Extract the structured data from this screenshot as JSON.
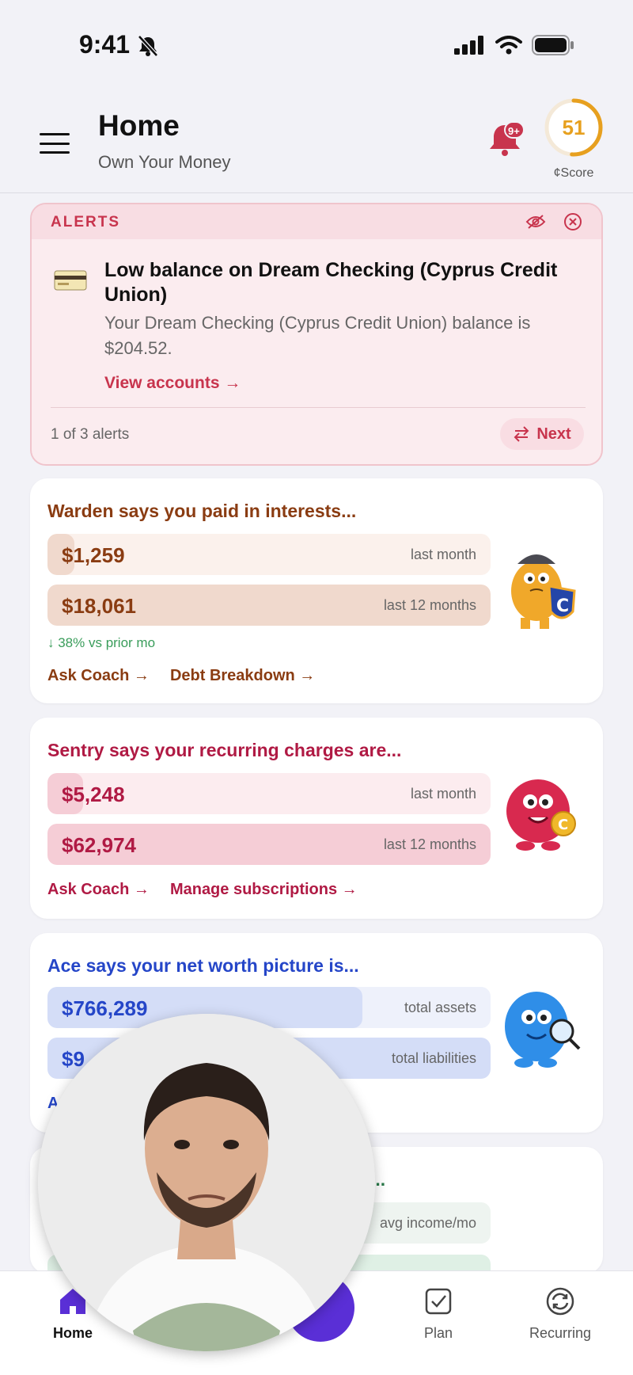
{
  "status_bar": {
    "time": "9:41"
  },
  "header": {
    "title": "Home",
    "subtitle": "Own Your Money",
    "notification_badge": "9+",
    "score_value": "51",
    "score_label": "¢Score",
    "score_fraction": 0.51
  },
  "alerts": {
    "label": "ALERTS",
    "title": "Low balance on Dream Checking (Cyprus Credit Union)",
    "body": "Your Dream Checking (Cyprus Credit Union) balance is $204.52.",
    "link": "View accounts →",
    "count": "1 of 3 alerts",
    "next_label": "Next"
  },
  "cards": [
    {
      "title": "Warden says you paid in interests...",
      "rows": [
        {
          "value": "$1,259",
          "label": "last month",
          "fill": 0.06
        },
        {
          "value": "$18,061",
          "label": "last 12 months",
          "fill": 1.0
        }
      ],
      "delta": "↓ 38% vs prior mo",
      "links": [
        "Ask Coach →",
        "Debt Breakdown →"
      ]
    },
    {
      "title": "Sentry says your recurring charges are...",
      "rows": [
        {
          "value": "$5,248",
          "label": "last month",
          "fill": 0.08
        },
        {
          "value": "$62,974",
          "label": "last 12 months",
          "fill": 1.0
        }
      ],
      "links": [
        "Ask Coach →",
        "Manage subscriptions →"
      ]
    },
    {
      "title": "Ace says your net worth picture is...",
      "rows": [
        {
          "value": "$766,289",
          "label": "total assets",
          "fill": 0.71
        },
        {
          "value": "$9",
          "label": "total liabilities",
          "fill": 1.0
        }
      ],
      "links": [
        "A"
      ]
    },
    {
      "title": "...",
      "rows": [
        {
          "value": "",
          "label": "avg income/mo"
        }
      ]
    }
  ],
  "nav": {
    "home": "Home",
    "plan": "Plan",
    "recurring": "Recurring"
  },
  "colors": {
    "alert_red": "#c8344d",
    "warden": "#8a3c12",
    "sentry": "#b01a44",
    "ace": "#2546c8",
    "accent_purple": "#5a2fd6",
    "score_orange": "#e7a01f"
  }
}
